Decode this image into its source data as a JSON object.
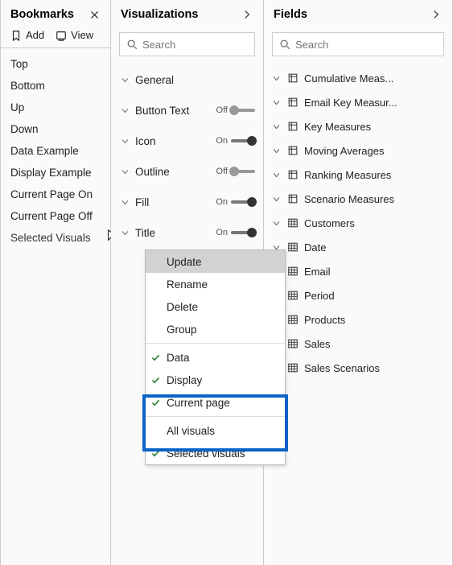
{
  "bookmarks": {
    "title": "Bookmarks",
    "add_label": "Add",
    "view_label": "View",
    "items": [
      {
        "label": "Top"
      },
      {
        "label": "Bottom"
      },
      {
        "label": "Up"
      },
      {
        "label": "Down"
      },
      {
        "label": "Data Example"
      },
      {
        "label": "Display Example"
      },
      {
        "label": "Current Page On"
      },
      {
        "label": "Current Page Off"
      },
      {
        "label": "Selected Visuals"
      }
    ]
  },
  "visualizations": {
    "title": "Visualizations",
    "search_placeholder": "Search",
    "format_sections": [
      {
        "label": "General",
        "toggle": null
      },
      {
        "label": "Button Text",
        "toggle": "Off"
      },
      {
        "label": "Icon",
        "toggle": "On"
      },
      {
        "label": "Outline",
        "toggle": "Off"
      },
      {
        "label": "Fill",
        "toggle": "On"
      },
      {
        "label": "Title",
        "toggle": "On"
      }
    ]
  },
  "context_menu": {
    "items": [
      {
        "label": "Update",
        "checked": false,
        "hover": true
      },
      {
        "label": "Rename",
        "checked": false
      },
      {
        "label": "Delete",
        "checked": false
      },
      {
        "label": "Group",
        "checked": false
      },
      {
        "sep": true
      },
      {
        "label": "Data",
        "checked": true
      },
      {
        "label": "Display",
        "checked": true
      },
      {
        "label": "Current page",
        "checked": true
      },
      {
        "sep": true
      },
      {
        "label": "All visuals",
        "checked": false
      },
      {
        "label": "Selected visuals",
        "checked": true
      }
    ]
  },
  "fields": {
    "title": "Fields",
    "search_placeholder": "Search",
    "tables": [
      {
        "label": "Cumulative Meas...",
        "kind": "measure"
      },
      {
        "label": "Email Key Measur...",
        "kind": "measure"
      },
      {
        "label": "Key Measures",
        "kind": "measure"
      },
      {
        "label": "Moving Averages",
        "kind": "measure"
      },
      {
        "label": "Ranking Measures",
        "kind": "measure"
      },
      {
        "label": "Scenario Measures",
        "kind": "measure"
      },
      {
        "label": "Customers",
        "kind": "table"
      },
      {
        "label": "Date",
        "kind": "table"
      },
      {
        "label": "Email",
        "kind": "table"
      },
      {
        "label": "Period",
        "kind": "table"
      },
      {
        "label": "Products",
        "kind": "table"
      },
      {
        "label": "Sales",
        "kind": "table"
      },
      {
        "label": "Sales Scenarios",
        "kind": "table"
      }
    ]
  }
}
